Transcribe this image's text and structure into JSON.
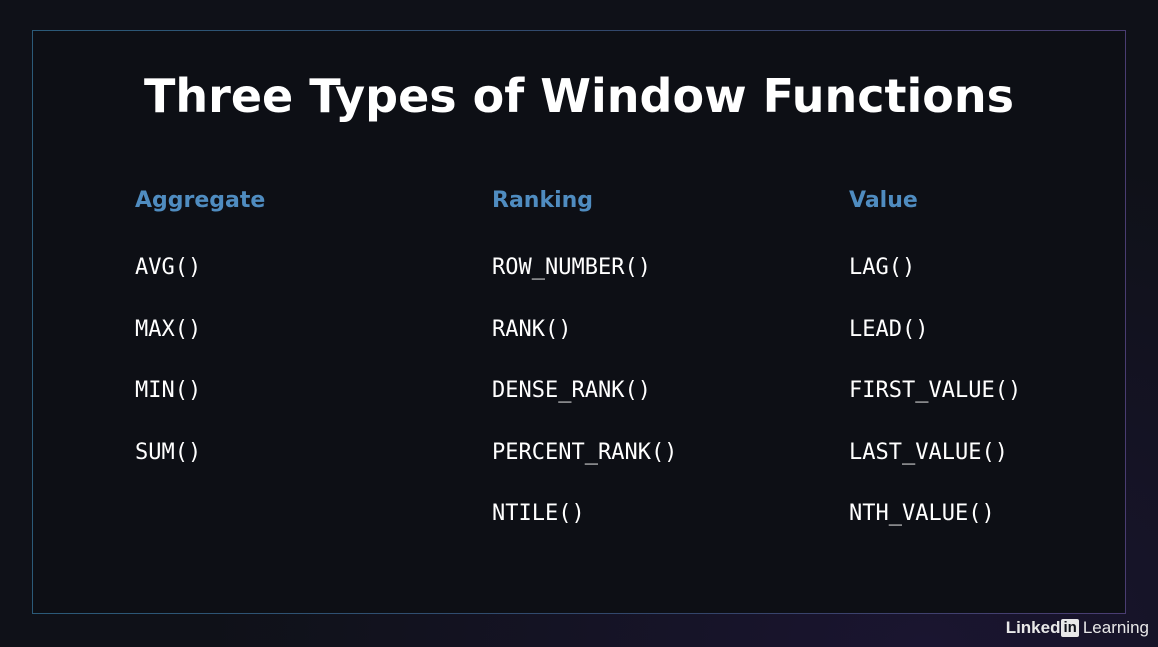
{
  "slide": {
    "title": "Three Types of Window Functions",
    "columns": [
      {
        "heading": "Aggregate",
        "functions": [
          "AVG()",
          "MAX()",
          "MIN()",
          "SUM()"
        ]
      },
      {
        "heading": "Ranking",
        "functions": [
          "ROW_NUMBER()",
          "RANK()",
          "DENSE_RANK()",
          "PERCENT_RANK()",
          "NTILE()"
        ]
      },
      {
        "heading": "Value",
        "functions": [
          "LAG()",
          "LEAD()",
          "FIRST_VALUE()",
          "LAST_VALUE()",
          "NTH_VALUE()"
        ]
      }
    ]
  },
  "watermark": {
    "brand_prefix": "Linked",
    "brand_in": "in",
    "brand_suffix": "Learning"
  },
  "colors": {
    "heading_accent": "#4f8cc0",
    "text": "#ffffff",
    "background": "#0d0f15"
  }
}
